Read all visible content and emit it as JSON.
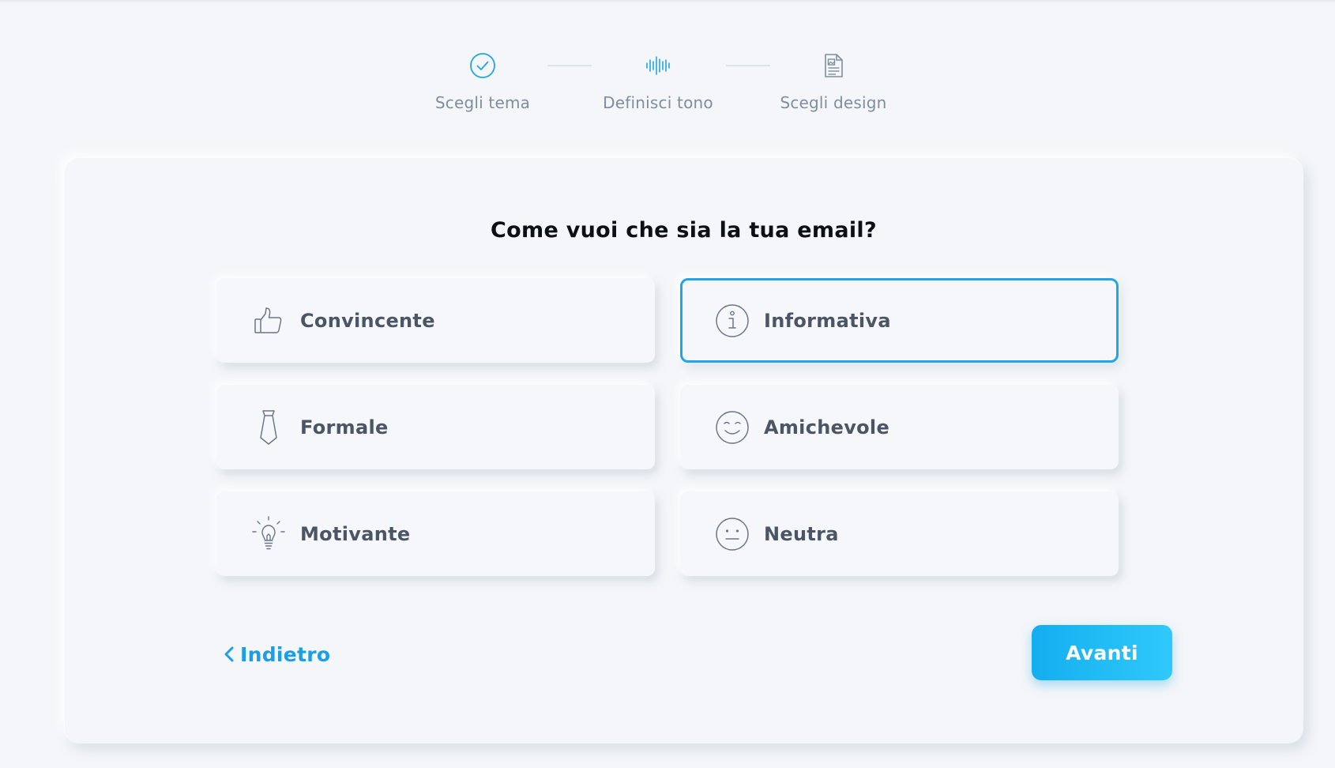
{
  "stepper": {
    "steps": [
      {
        "label": "Scegli tema",
        "icon": "check-circle-icon",
        "status": "completed"
      },
      {
        "label": "Definisci tono",
        "icon": "sound-wave-icon",
        "status": "active"
      },
      {
        "label": "Scegli design",
        "icon": "document-image-icon",
        "status": "pending"
      }
    ],
    "colors": {
      "active": "#1fa6ea",
      "inactive": "#7d8ea0",
      "line": "#dde3ea"
    }
  },
  "card": {
    "question": "Come vuoi che sia la tua email?",
    "options": [
      {
        "label": "Convincente",
        "icon": "thumbs-up-icon",
        "selected": false
      },
      {
        "label": "Informativa",
        "icon": "info-icon",
        "selected": true
      },
      {
        "label": "Formale",
        "icon": "tie-icon",
        "selected": false
      },
      {
        "label": "Amichevole",
        "icon": "smile-icon",
        "selected": false
      },
      {
        "label": "Motivante",
        "icon": "lightbulb-icon",
        "selected": false
      },
      {
        "label": "Neutra",
        "icon": "neutral-face-icon",
        "selected": false
      }
    ],
    "back_label": "Indietro",
    "next_label": "Avanti"
  },
  "colors": {
    "accent": "#1fa6ea",
    "background": "#f4f6f9",
    "option_text": "#4a5566",
    "heading": "#0c0f14"
  }
}
